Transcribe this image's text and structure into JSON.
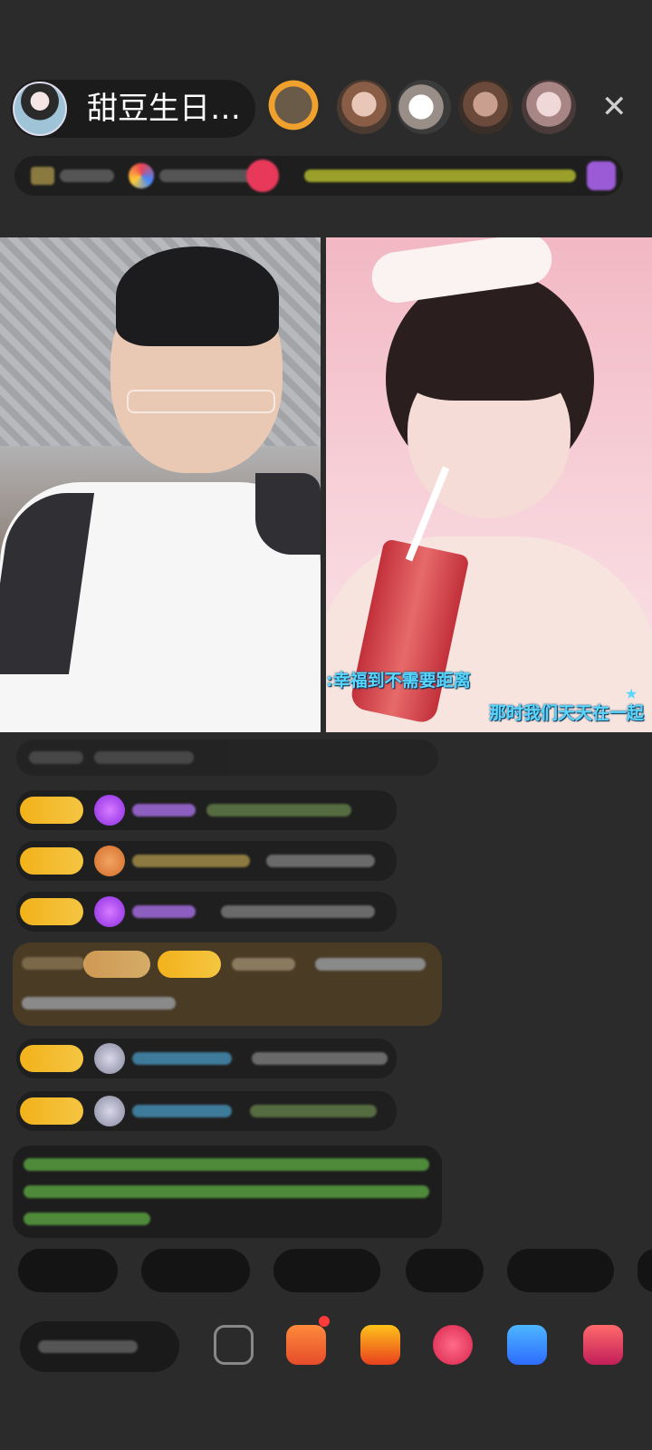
{
  "header": {
    "host_name": "甜豆生日…",
    "close_icon_glyph": "✕"
  },
  "video": {
    "lyric_left": ":幸福到不需要距离",
    "lyric_right": "那时我们天天在一起"
  },
  "colors": {
    "background": "#2b2b2b",
    "badge_gold": "#f2b21b",
    "lyric_blue": "#5ad7ff"
  }
}
